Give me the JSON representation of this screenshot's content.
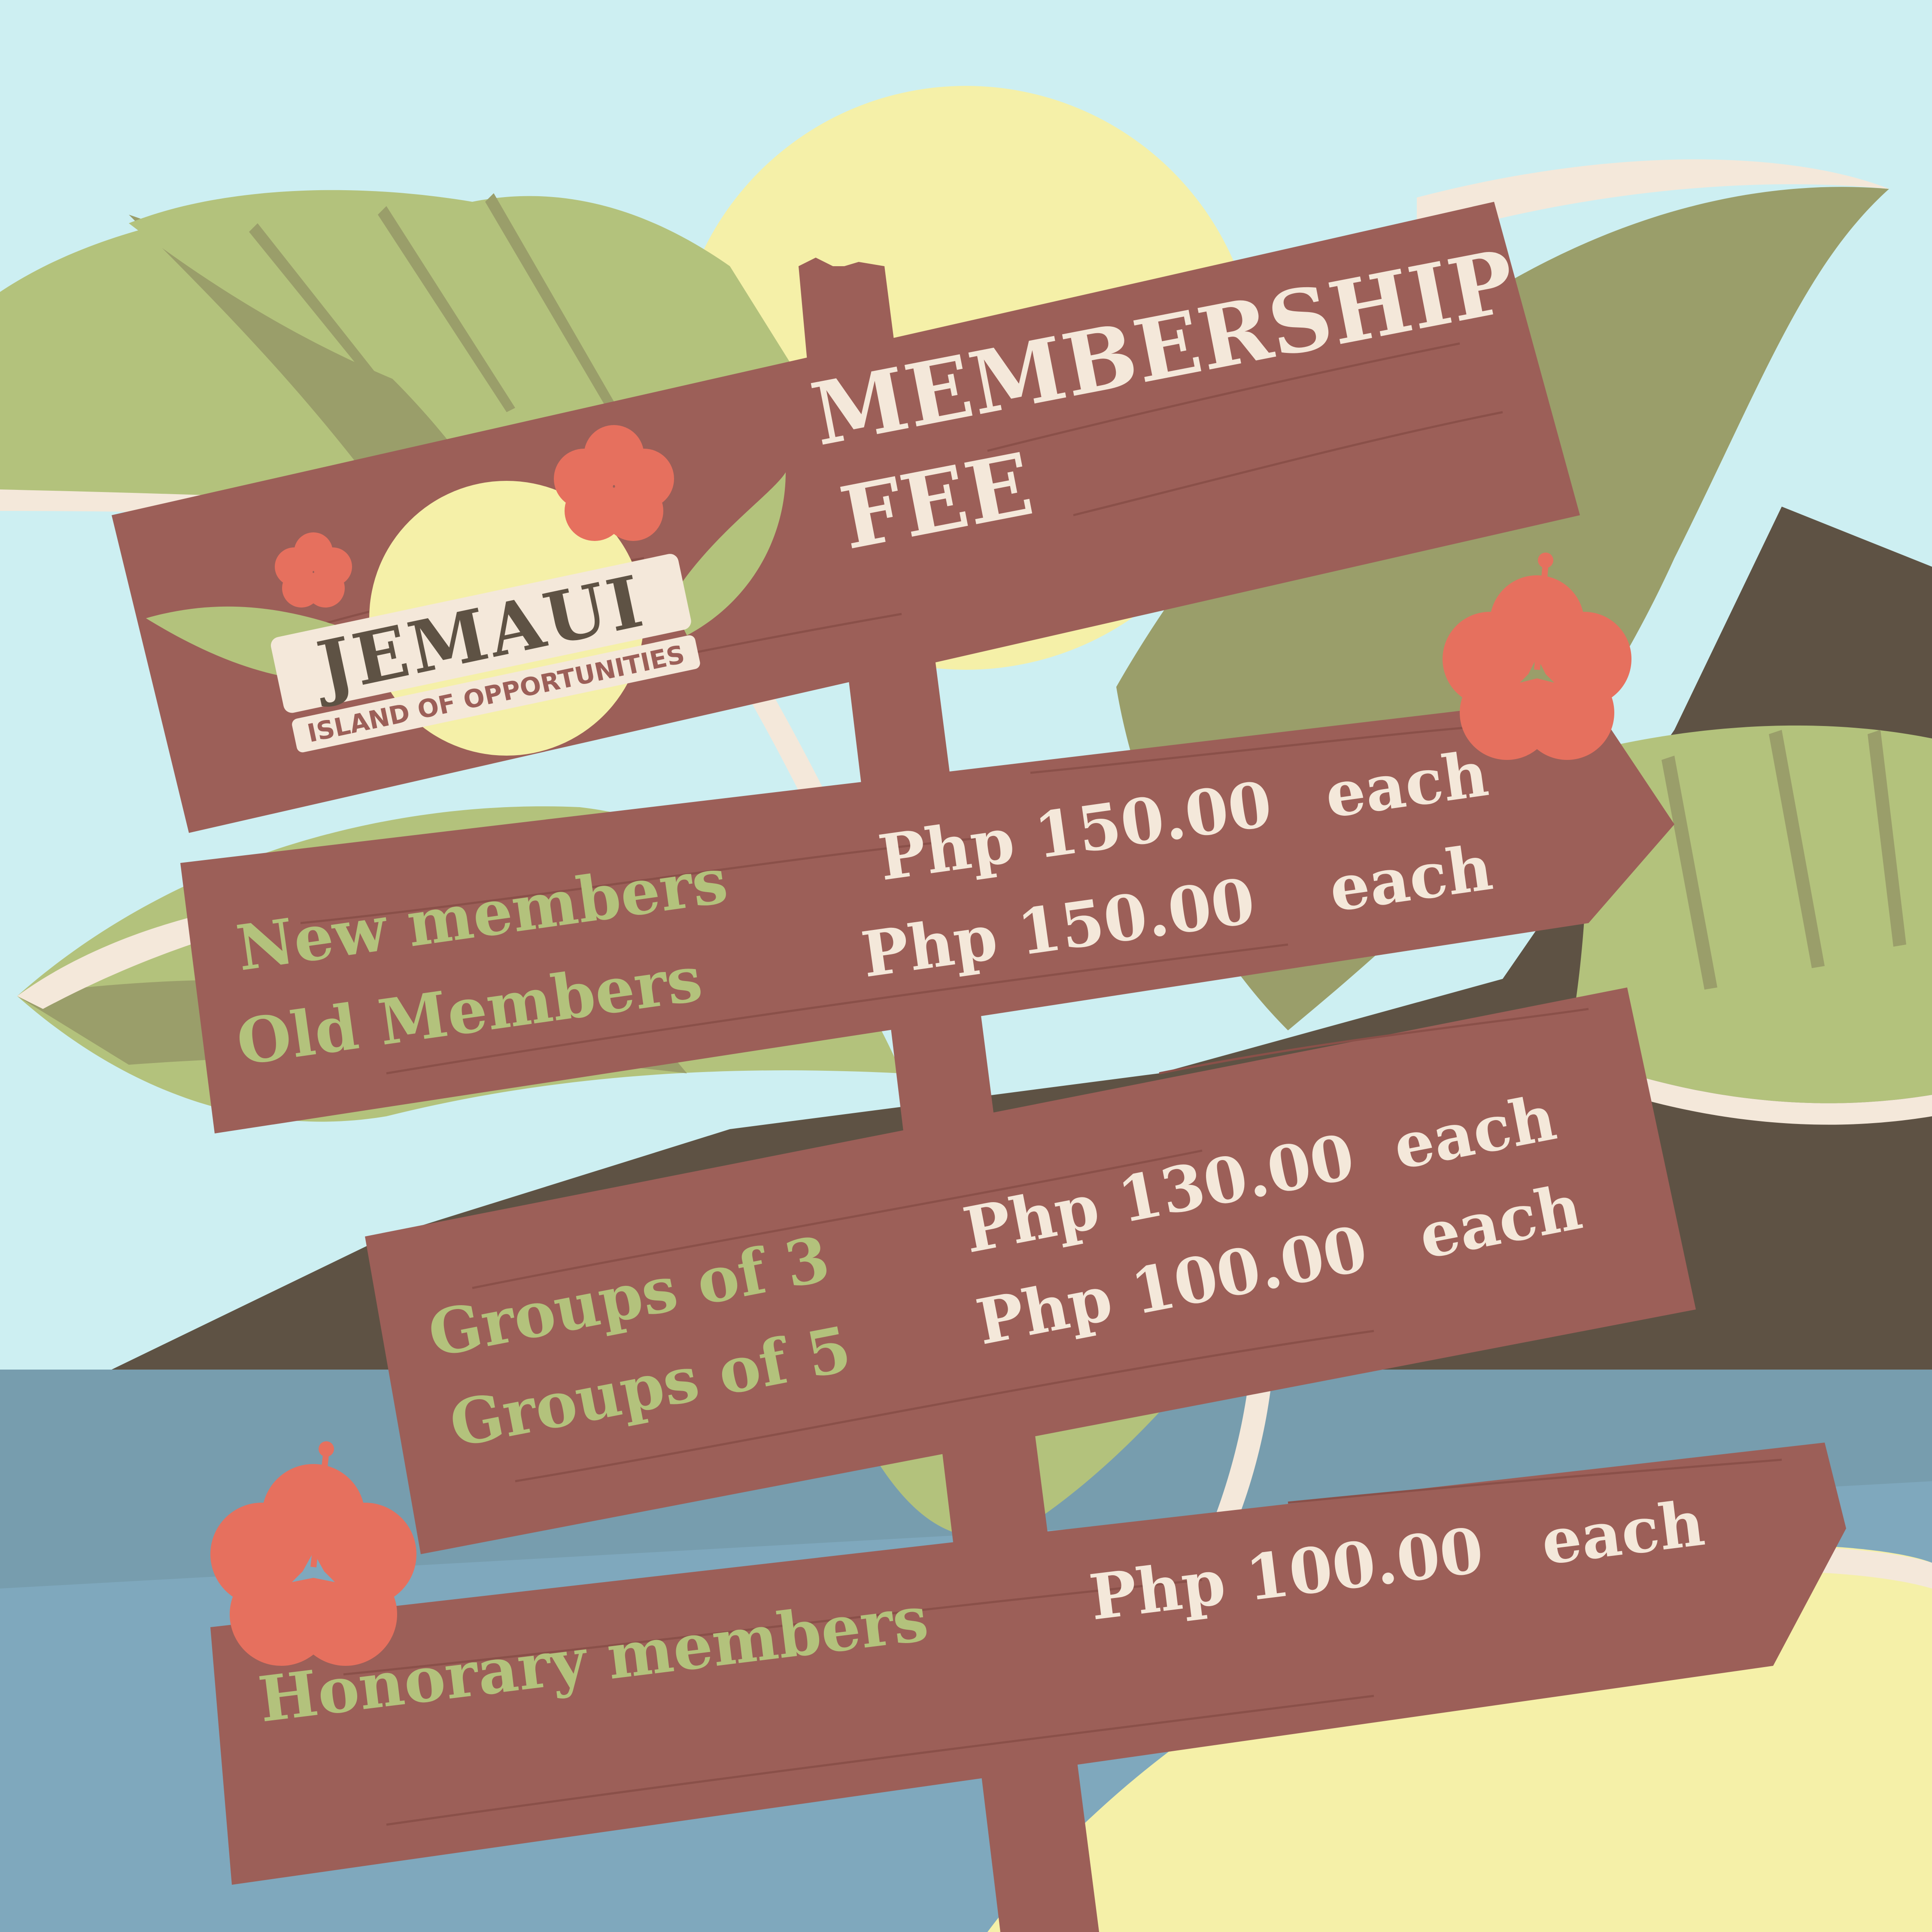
{
  "logo": {
    "wordmark": "JEMAUI",
    "tagline": "ISLAND OF OPPORTUNITIES"
  },
  "title": {
    "line1": "MEMBERSHIP",
    "line2": "FEE"
  },
  "fees": [
    {
      "label": "New members",
      "price": "Php 150.00",
      "unit": "each"
    },
    {
      "label": "Old Members",
      "price": "Php  150.00",
      "unit": "each"
    },
    {
      "label": "Groups of 3",
      "price": "Php 130.00",
      "unit": "each"
    },
    {
      "label": "Groups of 5",
      "price": "Php 100.00",
      "unit": "each"
    },
    {
      "label": "Honorary members",
      "price": "Php 100.00",
      "unit": "each"
    }
  ],
  "colors": {
    "sky": "#cdeff2",
    "sun": "#f5f0a8",
    "sea": "#7fa8bd",
    "mountain": "#5e5244",
    "leaf_light": "#b3c27c",
    "leaf_dark": "#9a9e6a",
    "wood": "#9c5f58",
    "hibiscus": "#e6705e",
    "label_green": "#b3c27c",
    "price_cream": "#f4e8da"
  }
}
